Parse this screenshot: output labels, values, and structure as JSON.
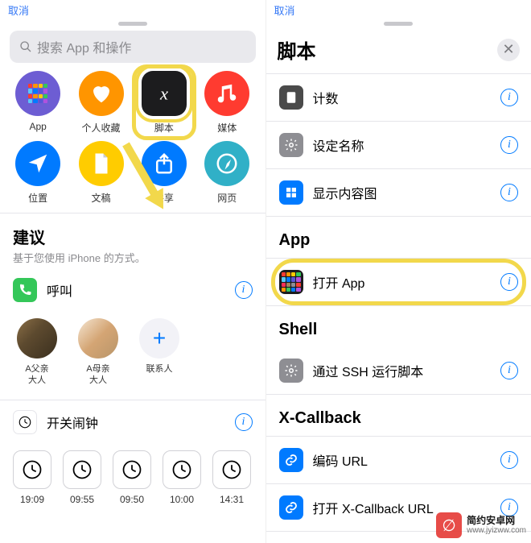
{
  "left": {
    "top_hint": "取消",
    "search_placeholder": "搜索 App 和操作",
    "categories": [
      {
        "label": "App",
        "color": "c-purple",
        "icon": "apps"
      },
      {
        "label": "个人收藏",
        "color": "c-orange",
        "icon": "heart"
      },
      {
        "label": "脚本",
        "color": "c-black",
        "icon": "script",
        "highlight": true
      },
      {
        "label": "媒体",
        "color": "c-red",
        "icon": "music"
      },
      {
        "label": "位置",
        "color": "c-blue",
        "icon": "location"
      },
      {
        "label": "文稿",
        "color": "c-yellow",
        "icon": "document"
      },
      {
        "label": "共享",
        "color": "c-blue",
        "icon": "share"
      },
      {
        "label": "网页",
        "color": "c-teal",
        "icon": "safari"
      }
    ],
    "suggestions": {
      "title": "建议",
      "subtitle": "基于您使用 iPhone 的方式。"
    },
    "call": {
      "label": "呼叫"
    },
    "contacts": [
      {
        "label": "A父亲\n大人",
        "img": 1
      },
      {
        "label": "A母亲\n大人",
        "img": 2
      },
      {
        "label": "联系人",
        "add": true
      }
    ],
    "alarm": {
      "label": "开关闹钟"
    },
    "alarm_times": [
      "19:09",
      "09:55",
      "09:50",
      "10:00",
      "14:31"
    ]
  },
  "right": {
    "top_hint": "取消",
    "title": "脚本",
    "items1": [
      {
        "label": "计数",
        "icon": "calculator",
        "bg": "ic-dark"
      },
      {
        "label": "设定名称",
        "icon": "gear",
        "bg": "ic-gray"
      },
      {
        "label": "显示内容图",
        "icon": "layout",
        "bg": "ic-blue"
      }
    ],
    "section_app": "App",
    "app_item": {
      "label": "打开 App",
      "icon": "apps-color"
    },
    "section_shell": "Shell",
    "shell_item": {
      "label": "通过 SSH 运行脚本",
      "icon": "gear",
      "bg": "ic-gray"
    },
    "section_xcb": "X-Callback",
    "xcb_items": [
      {
        "label": "编码 URL",
        "icon": "link",
        "bg": "ic-blue"
      },
      {
        "label": "打开 X-Callback URL",
        "icon": "link",
        "bg": "ic-blue"
      }
    ]
  },
  "watermark": {
    "cn": "简约安卓网",
    "url": "www.jyizww.com"
  }
}
